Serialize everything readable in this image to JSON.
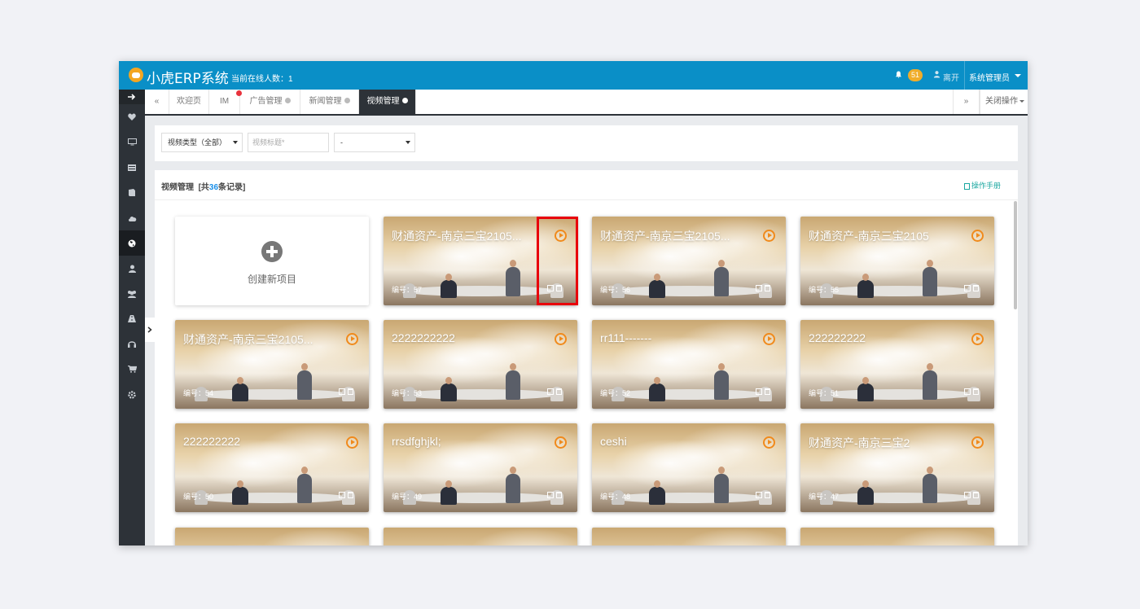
{
  "header": {
    "app_title": "小虎ERP系统",
    "online_label": "当前在线人数：1",
    "notification_count": "51",
    "leave_label": "离开",
    "user_label": "系统管理员"
  },
  "tabs": {
    "prev": "«",
    "next": "»",
    "close_ops": "关闭操作",
    "items": [
      {
        "label": "欢迎页"
      },
      {
        "label": "IM"
      },
      {
        "label": "广告管理"
      },
      {
        "label": "新闻管理"
      },
      {
        "label": "视频管理"
      }
    ]
  },
  "filter": {
    "type_select": "视频类型（全部）",
    "title_placeholder": "视频标题*",
    "extra_select": "-"
  },
  "panel": {
    "title_prefix": "视频管理",
    "title_count_pre": "[共",
    "count": "36",
    "title_count_post": "条记录]",
    "manual": "操作手册",
    "new_project": "创建新项目"
  },
  "cards": [
    {
      "title": "财通资产-南京三宝2105...",
      "number": "编号：57"
    },
    {
      "title": "财通资产-南京三宝2105...",
      "number": "编号：56"
    },
    {
      "title": "财通资产-南京三宝2105",
      "number": "编号：55"
    },
    {
      "title": "财通资产-南京三宝2105...",
      "number": "编号：54"
    },
    {
      "title": "2222222222",
      "number": "编号：53"
    },
    {
      "title": "rr111-------",
      "number": "编号：52"
    },
    {
      "title": "222222222",
      "number": "编号：51"
    },
    {
      "title": "222222222",
      "number": "编号：50"
    },
    {
      "title": "rrsdfghjkl;",
      "number": "编号：49"
    },
    {
      "title": "ceshi",
      "number": "编号：48"
    },
    {
      "title": "财通资产-南京三宝2",
      "number": "编号：47"
    }
  ],
  "colors": {
    "topbar": "#0a8fc7",
    "sidebar": "#2d3238",
    "accent_orange": "#f08a1c",
    "highlight_red": "#e8000b"
  }
}
